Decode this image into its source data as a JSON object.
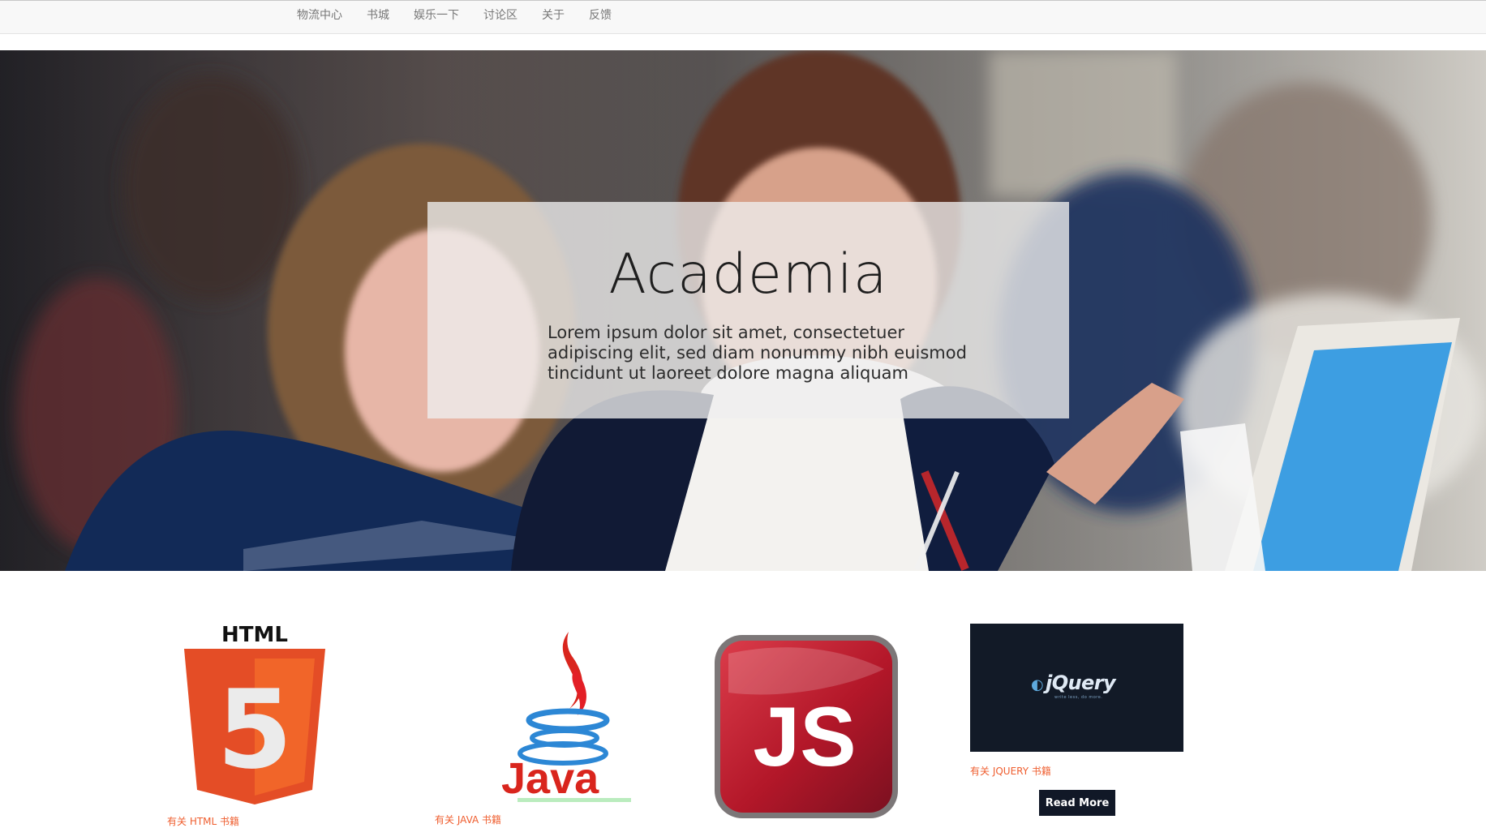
{
  "nav": {
    "items": [
      "物流中心",
      "书城",
      "娱乐一下",
      "讨论区",
      "关于",
      "反馈"
    ]
  },
  "hero": {
    "title": "Academia",
    "text": "Lorem ipsum dolor sit amet, consectetuer adipiscing elit, sed diam nonummy nibh euismod tincidunt ut laoreet dolore magna aliquam"
  },
  "books": {
    "html": {
      "logo_text": "HTML",
      "number": "5",
      "link": "有关 HTML 书籍"
    },
    "java": {
      "logo_text": "Java",
      "link": "有关 JAVA 书籍"
    },
    "js": {
      "logo_text": "JS"
    },
    "jquery": {
      "logo_text": "jQuery",
      "tagline": "write less, do more.",
      "link": "有关 JQUERY 书籍",
      "button_label": "Read More"
    }
  },
  "colors": {
    "nav_bg": "#f8f8f8",
    "nav_text": "#777777",
    "link": "#ef5e2f",
    "button": "#111827",
    "html5_orange": "#e44d26",
    "js_red": "#b31729"
  }
}
